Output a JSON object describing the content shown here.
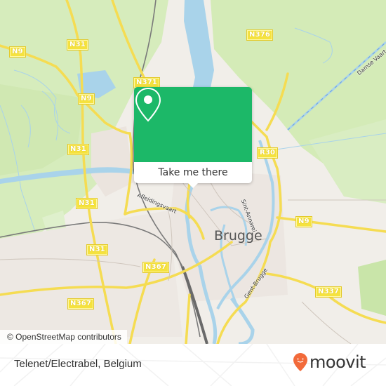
{
  "map": {
    "road_labels": [
      {
        "id": "n9-nw",
        "text": "N9"
      },
      {
        "id": "n31-n",
        "text": "N31"
      },
      {
        "id": "n9-mid",
        "text": "N9"
      },
      {
        "id": "n31-mid",
        "text": "N31"
      },
      {
        "id": "n371",
        "text": "N371"
      },
      {
        "id": "n376",
        "text": "N376"
      },
      {
        "id": "r30",
        "text": "R30"
      },
      {
        "id": "n31-sw",
        "text": "N31"
      },
      {
        "id": "n31-s",
        "text": "N31"
      },
      {
        "id": "n367-e",
        "text": "N367"
      },
      {
        "id": "n367-w",
        "text": "N367"
      },
      {
        "id": "n9-e",
        "text": "N9"
      },
      {
        "id": "n337",
        "text": "N337"
      }
    ],
    "place_label": "Brugge",
    "street_labels": {
      "damse_vaart": "Damse Vaart",
      "afleidingsvaart": "Afleidingsvaart",
      "sint_annarei": "Sint-Annarei",
      "gentpoortvest": "Gent-Brugge"
    },
    "colors": {
      "land": "#f1eee9",
      "green": "#d4ecb8",
      "water": "#a9d3ea",
      "road": "#f5dc52",
      "rail": "#777777"
    }
  },
  "popup": {
    "icon": "map-pin-icon",
    "button_label": "Take me there",
    "color": "#1cb868"
  },
  "attribution": "© OpenStreetMap contributors",
  "footer": {
    "location_name": "Telenet/Electrabel, Belgium",
    "logo_text": "moovit",
    "logo_icon": "moovit-pin-icon",
    "logo_color": "#f26a3a"
  }
}
